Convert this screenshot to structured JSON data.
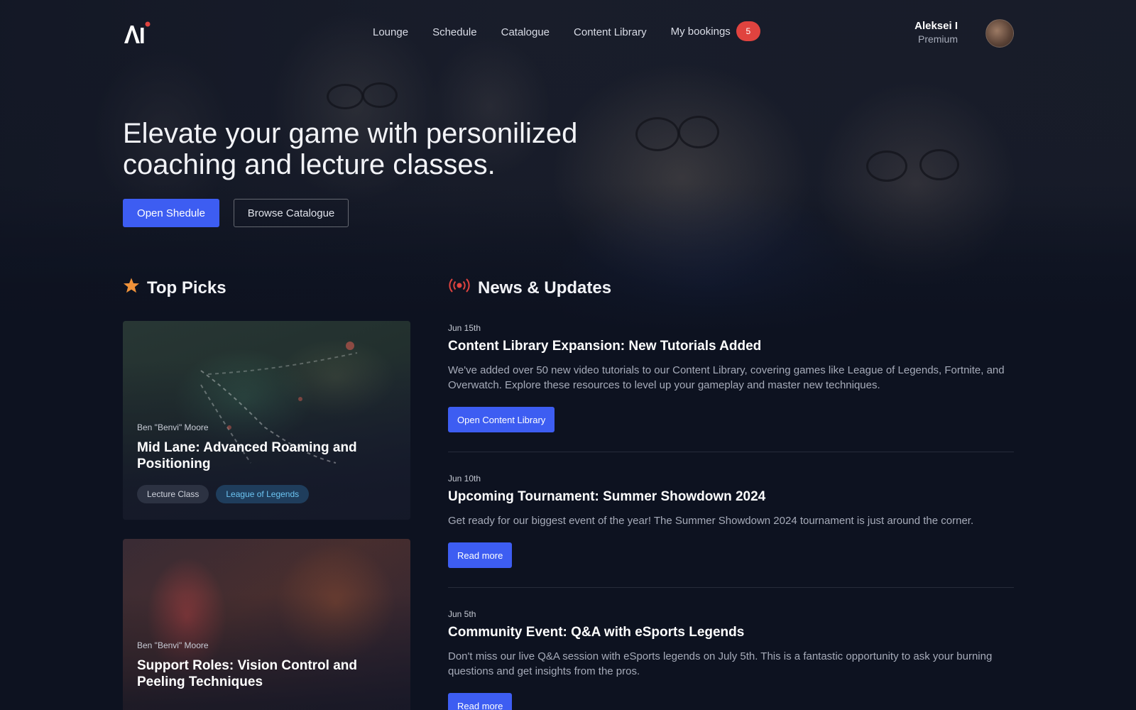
{
  "nav": {
    "links": [
      "Lounge",
      "Schedule",
      "Catalogue",
      "Content Library"
    ],
    "bookings_label": "My bookings",
    "bookings_count": "5"
  },
  "user": {
    "name": "Aleksei I",
    "plan": "Premium"
  },
  "hero": {
    "title": "Elevate your game with personilized coaching and lecture classes.",
    "primary_button": "Open Shedule",
    "secondary_button": "Browse Catalogue"
  },
  "top_picks": {
    "heading": "Top Picks",
    "cards": [
      {
        "author": "Ben \"Benvi\" Moore",
        "title": "Mid Lane: Advanced Roaming and Positioning",
        "tags": [
          "Lecture Class",
          "League of Legends"
        ]
      },
      {
        "author": "Ben \"Benvi\" Moore",
        "title": "Support Roles: Vision Control and Peeling Techniques",
        "tags": []
      }
    ]
  },
  "news": {
    "heading": "News & Updates",
    "items": [
      {
        "date": "Jun 15th",
        "title": "Content Library Expansion: New Tutorials Added",
        "text": "We've added over 50 new video tutorials to our Content Library, covering games like League of Legends, Fortnite, and Overwatch. Explore these resources to level up your gameplay and master new techniques.",
        "button": "Open Content Library"
      },
      {
        "date": "Jun 10th",
        "title": "Upcoming Tournament: Summer Showdown 2024",
        "text": "Get ready for our biggest event of the year! The Summer Showdown 2024 tournament is just around the corner.",
        "button": "Read more"
      },
      {
        "date": "Jun 5th",
        "title": "Community Event: Q&A with eSports Legends",
        "text": "Don't miss our live Q&A session with eSports legends on July 5th. This is a fantastic opportunity to ask your burning questions and get insights from the pros.",
        "button": "Read more"
      }
    ]
  },
  "colors": {
    "accent": "#3d5df2",
    "badge": "#e0433f",
    "star": "#f0923a",
    "broadcast": "#e0433f",
    "background": "#0d1220"
  },
  "icons": {
    "logo": "ai-logo-icon",
    "star": "star-icon",
    "broadcast": "broadcast-icon"
  }
}
